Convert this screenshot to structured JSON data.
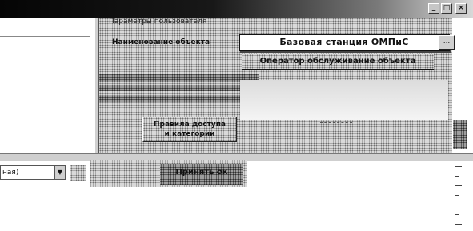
{
  "window": {
    "title": "",
    "buttons": {
      "minimize": "_",
      "maximize": "□",
      "close": "×"
    }
  },
  "group": {
    "caption": "Параметры пользователя",
    "field_label": "Наименование объекта"
  },
  "popup": {
    "value": "Базовая станция ОМПиС",
    "ellipsis": "..."
  },
  "subitem": {
    "label": "Оператор обслуживание объекта"
  },
  "access_button": {
    "line1": "Правила доступа",
    "line2": "и категории"
  },
  "combo": {
    "value": "ная)",
    "arrow": "▼"
  },
  "ok_button": {
    "label": "Принять ок",
    "sub": ""
  },
  "colors": {
    "titlebar_dark": "#050505",
    "panel_grey": "#bdbdbd",
    "text": "#111111"
  }
}
